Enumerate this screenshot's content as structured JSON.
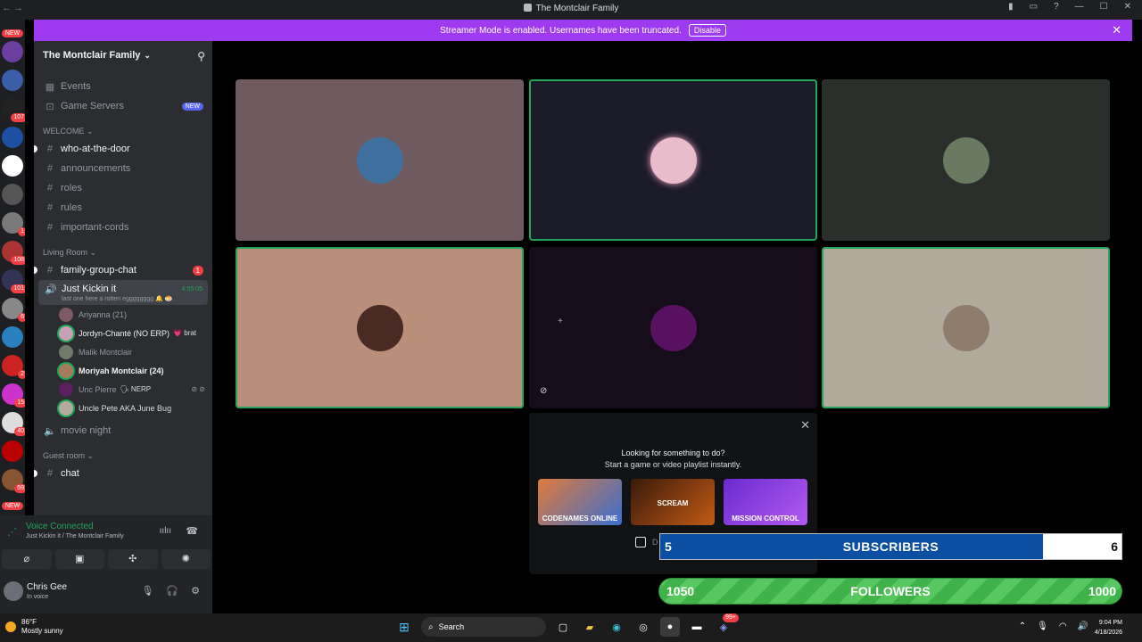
{
  "window": {
    "title": "The Montclair Family"
  },
  "banner": {
    "text": "Streamer Mode is enabled. Usernames have been truncated.",
    "button": "Disable"
  },
  "guild_rail": {
    "new_top": "NEW",
    "badges": [
      "107",
      "1",
      "108",
      "101",
      "6",
      "2",
      "15",
      "40",
      "59"
    ],
    "new_bottom": "NEW"
  },
  "server": {
    "name": "The Montclair Family",
    "shortcuts": [
      {
        "label": "Events"
      },
      {
        "label": "Game Servers",
        "badge": "NEW"
      }
    ],
    "categories": [
      {
        "name": "WELCOME",
        "channels": [
          "who-at-the-door",
          "announcements",
          "roles",
          "rules",
          "important-cords"
        ]
      },
      {
        "name": "Living Room"
      },
      {
        "name": "Guest room"
      }
    ],
    "family_group_chat": {
      "name": "family-group-chat",
      "mentions": "1"
    },
    "voice_channel": {
      "name": "Just Kickin it",
      "timer": "4:55:05",
      "status": "last one here a rotten egggggggg 🔔 🍮",
      "users": [
        {
          "name": "Ariyanna (21)",
          "tag": ""
        },
        {
          "name": "Jordyn-Chanté (NO ERP)",
          "tag": "💗 brat"
        },
        {
          "name": "Malik Montclair",
          "tag": ""
        },
        {
          "name": "Moriyah Montclair (24)",
          "tag": ""
        },
        {
          "name": "Unc Pierre",
          "tag": "🗣 NERP"
        },
        {
          "name": "Uncle Pete AKA June Bug",
          "tag": ""
        }
      ]
    },
    "movie_night": "movie night",
    "chat": "chat"
  },
  "voice_connected": {
    "status": "Voice Connected",
    "location": "Just Kickin it / The Montclair Family"
  },
  "user_panel": {
    "name": "Chris Gee",
    "status": "In voice"
  },
  "activity": {
    "line1": "Looking for something to do?",
    "line2": "Start a game or video playlist instantly.",
    "games": [
      "CODENAMES ONLINE",
      "SCREAM",
      "MISSION CONTROL"
    ],
    "checkbox_label": "D"
  },
  "subscribers": {
    "current": "5",
    "label": "SUBSCRIBERS",
    "goal": "6",
    "progress": 0.83
  },
  "followers": {
    "current": "1050",
    "label": "FOLLOWERS",
    "goal": "1000"
  },
  "taskbar": {
    "weather_temp": "86°F",
    "weather_desc": "Mostly sunny",
    "search": "Search",
    "time": "9:04 PM",
    "date": "4/18/2026",
    "discord_badge": "99+"
  }
}
